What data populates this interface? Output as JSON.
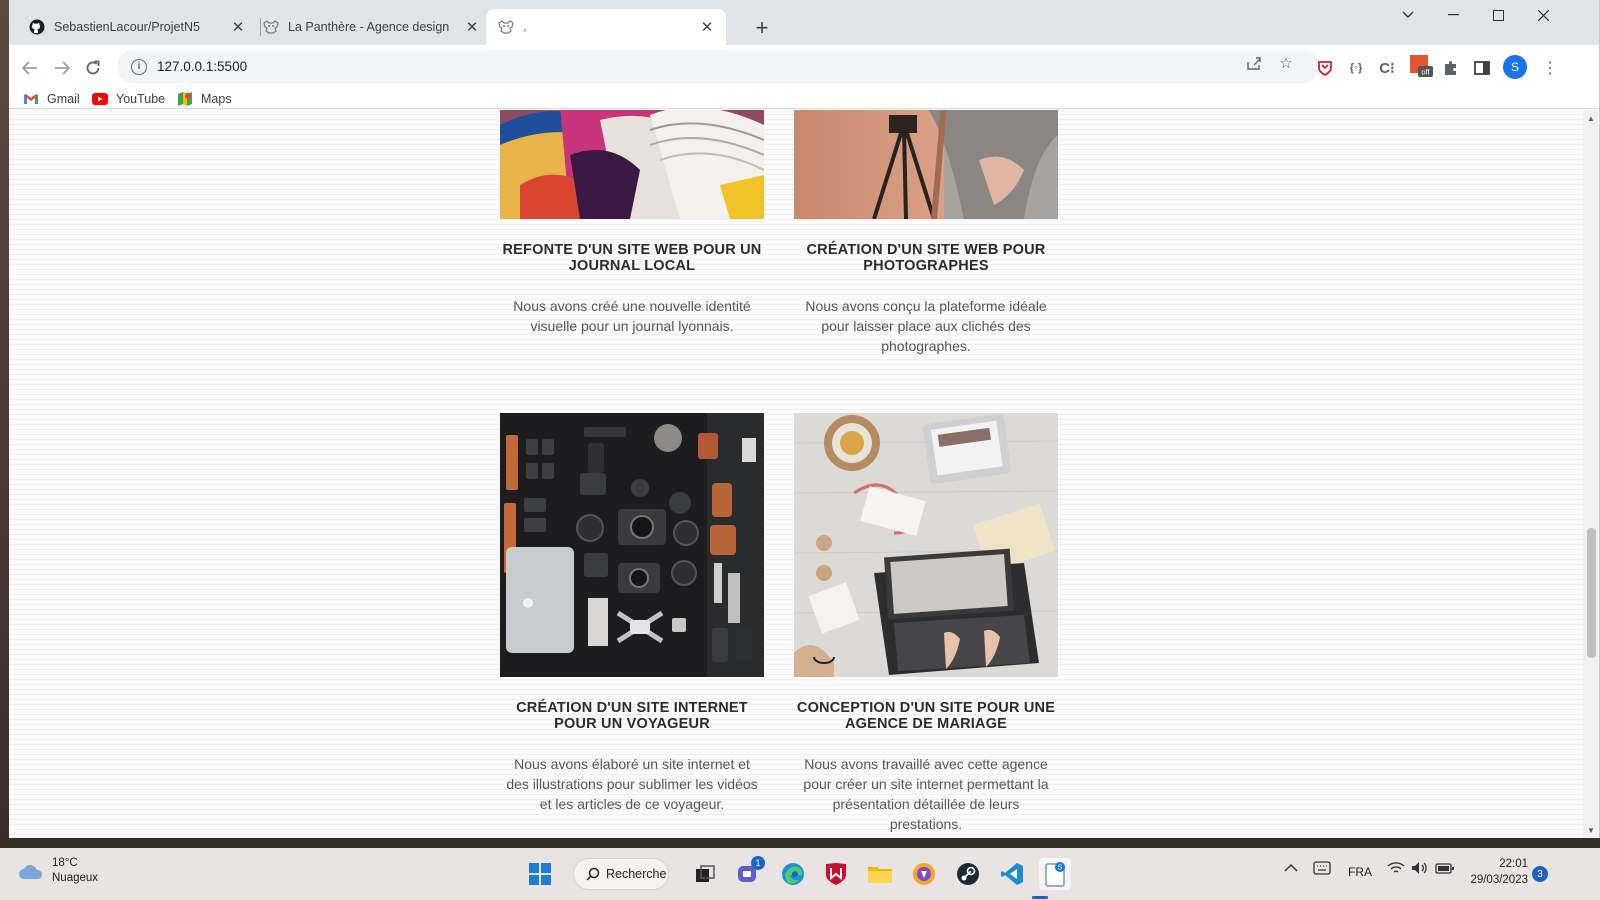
{
  "browser": {
    "tabs": [
      {
        "label": "SebastienLacour/ProjetN5",
        "icon": "github-icon"
      },
      {
        "label": "La Panthère - Agence design",
        "icon": "panther-icon"
      },
      {
        "label": ".",
        "icon": "panther-icon"
      }
    ],
    "url": "127.0.0.1:5500",
    "bookmarks": [
      "Gmail",
      "YouTube",
      "Maps"
    ],
    "profile_initial": "S",
    "extension_badge": "off"
  },
  "page": {
    "cards": [
      {
        "title": "Refonte d'un site web pour un journal local",
        "text": "Nous avons créé une nouvelle identité visuelle pour un journal lyonnais.",
        "image": "magazines-photo"
      },
      {
        "title": "Création d'un site web pour photographes",
        "text": "Nous avons conçu la plateforme idéale pour laisser place aux clichés des photographes.",
        "image": "photographer-tripod-photo"
      },
      {
        "title": "Création d'un site internet pour un voyageur",
        "text": "Nous avons élaboré un site internet et des illustrations pour sublimer les vidéos et les articles de ce voyageur.",
        "image": "camera-gear-flatlay-photo"
      },
      {
        "title": "Conception d'un site pour une agence de mariage",
        "text": "Nous avons travaillé avec cette agence pour créer un site internet permettant la présentation détaillée de leurs prestations.",
        "image": "laptop-desk-photo"
      }
    ]
  },
  "taskbar": {
    "weather_temp": "18°C",
    "weather_desc": "Nuageux",
    "search_label": "Recherche",
    "teams_badge": "1",
    "language": "FRA",
    "time": "22:01",
    "date": "29/03/2023",
    "notifications": "3"
  }
}
